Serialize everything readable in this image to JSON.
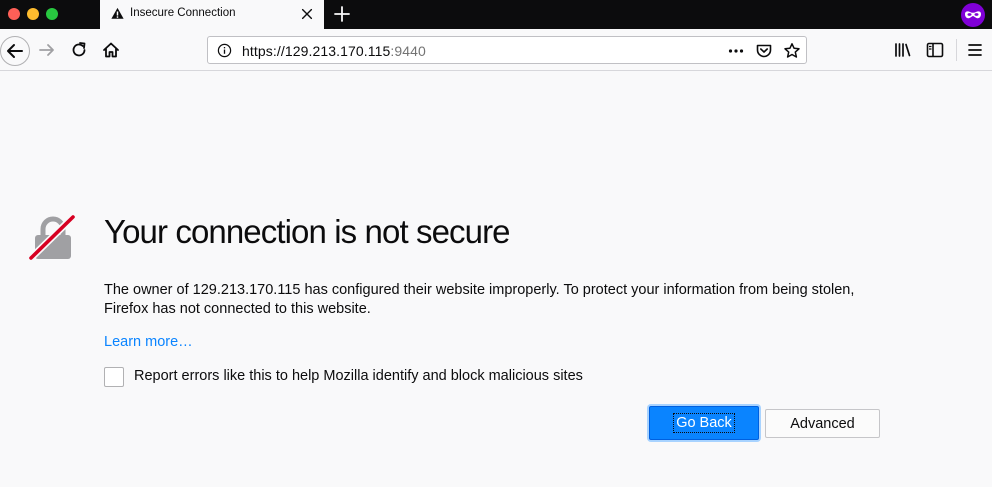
{
  "browser": {
    "tab_title": "Insecure Connection",
    "url_main": "https://129.213.170.115",
    "url_port": ":9440"
  },
  "error": {
    "heading": "Your connection is not secure",
    "description": "The owner of 129.213.170.115 has configured their website improperly. To protect your information from being stolen, Firefox has not connected to this website.",
    "learn_more": "Learn more…",
    "report_label": "Report errors like this to help Mozilla identify and block malicious sites",
    "go_back_label": "Go Back",
    "advanced_label": "Advanced"
  },
  "icons": {
    "tab": [
      "warning-icon",
      "close-icon",
      "new-tab-icon",
      "private-browsing-icon"
    ],
    "nav": [
      "back-icon",
      "forward-icon",
      "reload-icon",
      "home-icon"
    ],
    "url": [
      "info-icon",
      "page-actions-icon",
      "pocket-icon",
      "bookmark-star-icon"
    ],
    "toolbar": [
      "library-icon",
      "sidebar-icon",
      "menu-icon"
    ],
    "content": [
      "broken-lock-icon"
    ]
  },
  "colors": {
    "accent": "#0a84ff",
    "lock_strike": "#d70022",
    "page_background": "#f9f9fa"
  }
}
